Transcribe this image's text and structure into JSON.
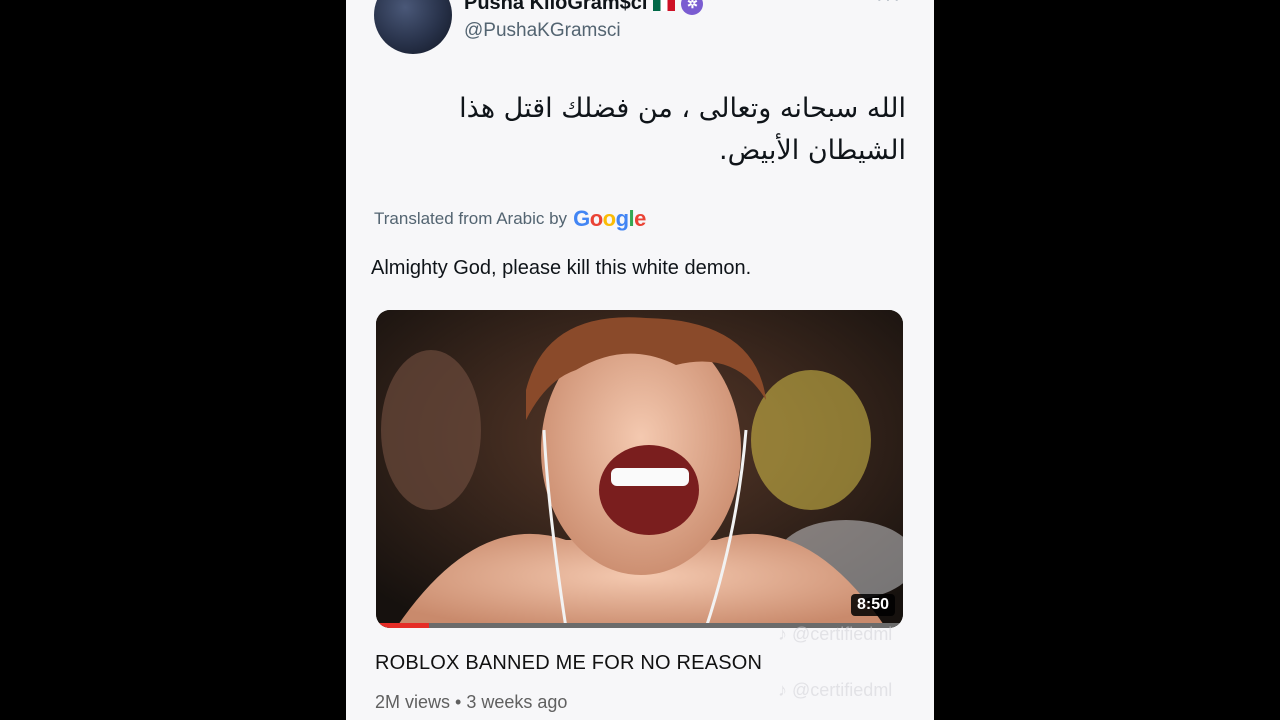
{
  "tweet": {
    "display_name": "Pusha KiloGram$ci",
    "handle": "@PushaKGramsci",
    "arabic_text": "الله سبحانه وتعالى ، من فضلك اقتل هذا الشيطان الأبيض.",
    "translated_label": "Translated from Arabic by",
    "translation_provider": "Google",
    "translation": "Almighty God, please kill this white demon."
  },
  "video": {
    "duration": "8:50",
    "progress": 0.1,
    "title": "ROBLOX BANNED ME FOR NO REASON",
    "meta": "2M views • 3 weeks ago"
  },
  "watermarks": {
    "primary": "@certifiedml",
    "secondary": "@certifiedml"
  },
  "colors": {
    "background": "#000000",
    "panel": "#f7f7f9",
    "progress_red": "#e52d27"
  },
  "icons": [
    "avatar",
    "mexico-flag-icon",
    "verified-badge-icon",
    "more-icon",
    "google-logo",
    "tiktok-icon"
  ]
}
